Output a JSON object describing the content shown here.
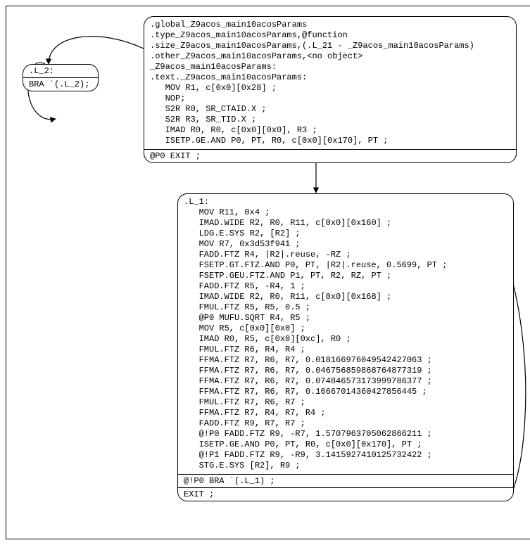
{
  "node_L2": {
    "title": ".L_2:",
    "body": "BRA `(.L_2);"
  },
  "node_main": {
    "header": ".global_Z9acos_main10acosParams\n.type_Z9acos_main10acosParams,@function\n.size_Z9acos_main10acosParams,(.L_21 - _Z9acos_main10acosParams)\n.other_Z9acos_main10acosParams,<no object>\n_Z9acos_main10acosParams:\n.text._Z9acos_main10acosParams:\n   MOV R1, c[0x0][0x28] ;\n   NOP;\n   S2R R0, SR_CTAID.X ;\n   S2R R3, SR_TID.X ;\n   IMAD R0, R0, c[0x0][0x0], R3 ;\n   ISETP.GE.AND P0, PT, R0, c[0x0][0x170], PT ;",
    "footer": "@P0 EXIT ;"
  },
  "node_L1": {
    "body": ".L_1:\n   MOV R11, 0x4 ;\n   IMAD.WIDE R2, R0, R11, c[0x0][0x160] ;\n   LDG.E.SYS R2, [R2] ;\n   MOV R7, 0x3d53f941 ;\n   FADD.FTZ R4, |R2|.reuse, -RZ ;\n   FSETP.GT.FTZ.AND P0, PT, |R2|.reuse, 0.5699, PT ;\n   FSETP.GEU.FTZ.AND P1, PT, R2, RZ, PT ;\n   FADD.FTZ R5, -R4, 1 ;\n   IMAD.WIDE R2, R0, R11, c[0x0][0x168] ;\n   FMUL.FTZ R5, R5, 0.5 ;\n   @P0 MUFU.SQRT R4, R5 ;\n   MOV R5, c[0x0][0x0] ;\n   IMAD R0, R5, c[0x0][0xc], R0 ;\n   FMUL.FTZ R6, R4, R4 ;\n   FFMA.FTZ R7, R6, R7, 0.018166976049542427063 ;\n   FFMA.FTZ R7, R6, R7, 0.046756859868764877319 ;\n   FFMA.FTZ R7, R6, R7, 0.074846573173999786377 ;\n   FFMA.FTZ R7, R6, R7, 0.16667014360427856445 ;\n   FMUL.FTZ R7, R6, R7 ;\n   FFMA.FTZ R7, R4, R7, R4 ;\n   FADD.FTZ R9, R7, R7 ;\n   @!P0 FADD.FTZ R9, -R7, 1.5707963705062866211 ;\n   ISETP.GE.AND P0, PT, R0, c[0x0][0x170], PT ;\n   @!P1 FADD.FTZ R9, -R9, 3.1415927410125732422 ;\n   STG.E.SYS [R2], R9 ;",
    "branch": "@!P0 BRA `(.L_1) ;",
    "exit": "EXIT ;"
  }
}
